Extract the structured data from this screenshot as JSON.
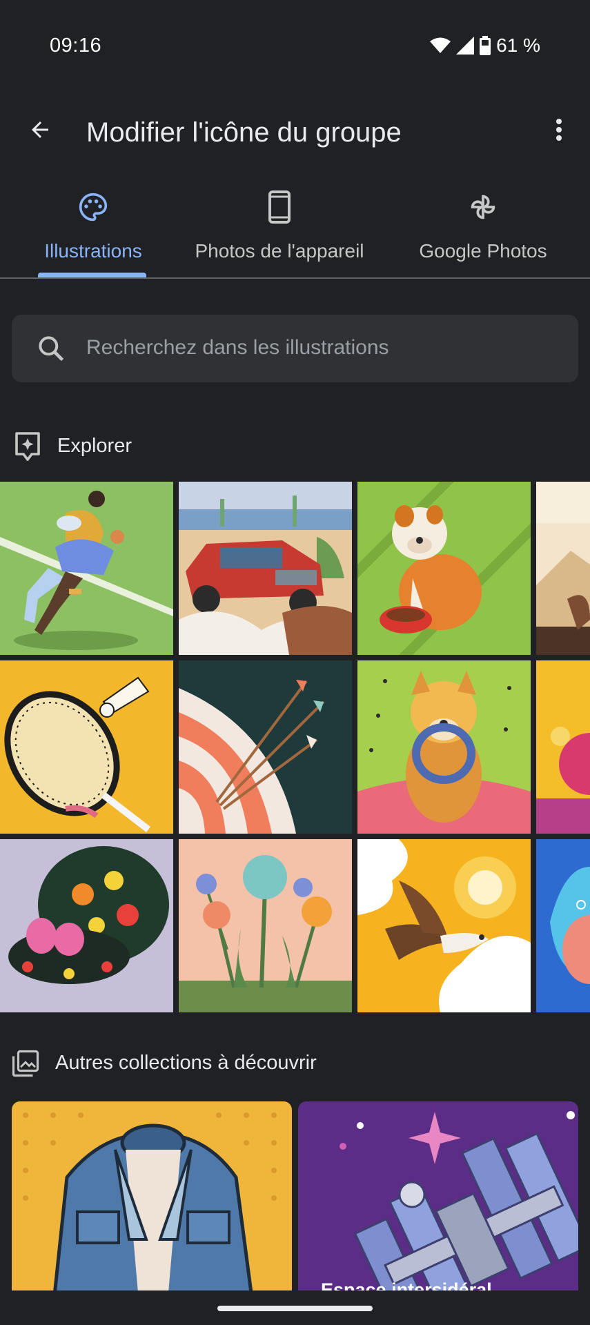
{
  "status": {
    "time": "09:16",
    "battery": "61 %"
  },
  "app_bar": {
    "title": "Modifier l'icône du groupe"
  },
  "tabs": [
    {
      "label": "Illustrations",
      "icon": "palette-icon",
      "active": true
    },
    {
      "label": "Photos de l'appareil",
      "icon": "phone-icon",
      "active": false
    },
    {
      "label": "Google Photos",
      "icon": "pinwheel-icon",
      "active": false
    }
  ],
  "search": {
    "placeholder": "Recherchez dans les illustrations"
  },
  "explore": {
    "title": "Explorer",
    "icon": "sparkle-square-icon"
  },
  "illustrations": [
    "rugby",
    "offroad-car",
    "bulldog",
    "desert",
    "badminton",
    "archery",
    "yorkshire-terrier",
    "flower",
    "painted-box",
    "wildflowers",
    "eagle",
    "fish"
  ],
  "collections": {
    "title": "Autres collections à découvrir",
    "icon": "photo-library-icon",
    "items": [
      {
        "label": ""
      },
      {
        "label": "Espace intersidéral"
      }
    ]
  },
  "colors": {
    "accent": "#8ab4f8",
    "background": "#202124",
    "surface": "#303134"
  }
}
